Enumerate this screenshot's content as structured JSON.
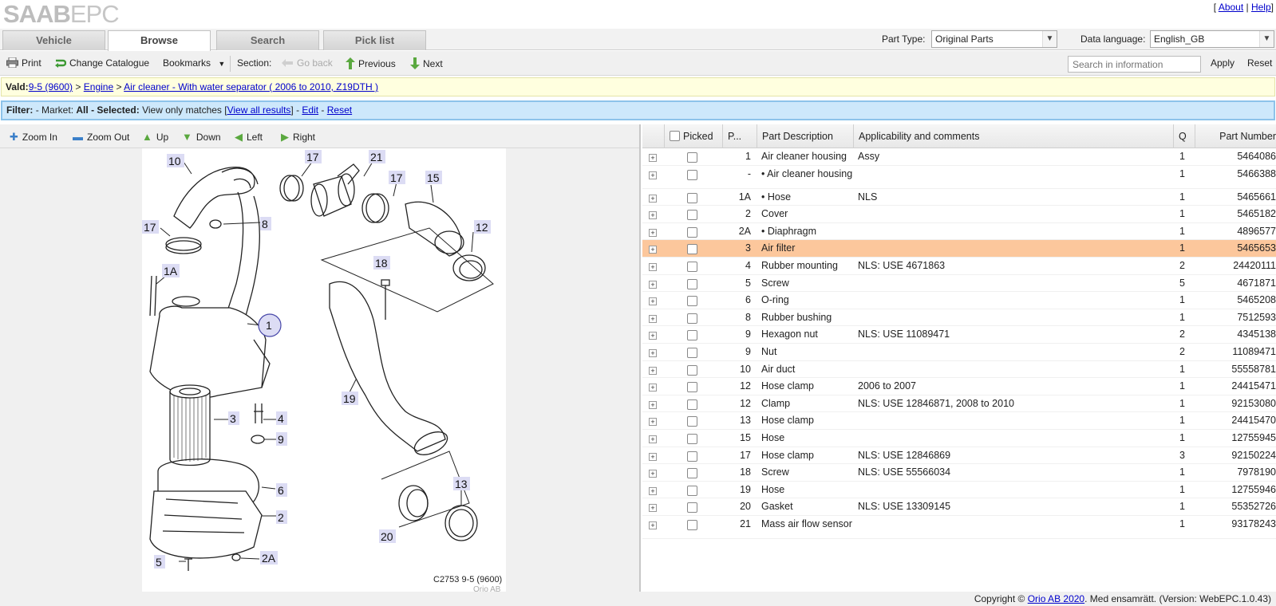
{
  "header": {
    "logo_main": "SAAB",
    "logo_sub": "EPC",
    "links": {
      "about": "About",
      "help": "Help"
    }
  },
  "tabs": [
    "Vehicle",
    "Browse",
    "Search",
    "Pick list"
  ],
  "active_tab": "Browse",
  "part_type": {
    "label": "Part Type:",
    "value": "Original Parts"
  },
  "data_language": {
    "label": "Data language:",
    "value": "English_GB"
  },
  "toolbar": {
    "print": "Print",
    "change_catalogue": "Change Catalogue",
    "bookmarks": "Bookmarks",
    "section": "Section:",
    "go_back": "Go back",
    "previous": "Previous",
    "next": "Next",
    "search_placeholder": "Search in information",
    "apply": "Apply",
    "reset": "Reset"
  },
  "valid_bar": {
    "label": "Vald:",
    "crumb1": "9-5 (9600)",
    "sep": ">",
    "crumb2": "Engine",
    "crumb3": "Air cleaner - With water separator ( 2006 to 2010, Z19DTH )"
  },
  "filter_bar": {
    "filter_label": "Filter:",
    "market_label": "- Market:",
    "market_value": "All",
    "selected_label": "- Selected:",
    "selected_value": "View only matches",
    "view_all": "View all results",
    "edit": "Edit",
    "reset": "Reset"
  },
  "view_tools": {
    "zoom_in": "Zoom In",
    "zoom_out": "Zoom Out",
    "up": "Up",
    "down": "Down",
    "left": "Left",
    "right": "Right"
  },
  "diagram": {
    "caption": "C2753 9-5 (9600)",
    "copyright": "Orio AB",
    "callouts": [
      "10",
      "17",
      "21",
      "17",
      "15",
      "17",
      "8",
      "12",
      "1A",
      "18",
      "1",
      "3",
      "4",
      "9",
      "19",
      "6",
      "2",
      "13",
      "20",
      "5",
      "2A"
    ]
  },
  "table": {
    "headers": {
      "picked": "Picked",
      "pos": "P...",
      "desc": "Part Description",
      "comments": "Applicability and comments",
      "qty": "Q",
      "part_number": "Part Number"
    },
    "rows": [
      {
        "pos": "1",
        "desc": "Air cleaner housing",
        "comments": "Assy",
        "qty": "1",
        "part": "5464086"
      },
      {
        "pos": "-",
        "desc": "• Air cleaner housing",
        "comments": "",
        "qty": "1",
        "part": "5466388"
      },
      {
        "pos": "1A",
        "desc": "• Hose",
        "comments": "NLS",
        "qty": "1",
        "part": "5465661"
      },
      {
        "pos": "2",
        "desc": "Cover",
        "comments": "",
        "qty": "1",
        "part": "5465182"
      },
      {
        "pos": "2A",
        "desc": "• Diaphragm",
        "comments": "",
        "qty": "1",
        "part": "4896577"
      },
      {
        "pos": "3",
        "desc": "Air filter",
        "comments": "",
        "qty": "1",
        "part": "5465653"
      },
      {
        "pos": "4",
        "desc": "Rubber mounting",
        "comments": "NLS: USE 4671863",
        "qty": "2",
        "part": "24420111"
      },
      {
        "pos": "5",
        "desc": "Screw",
        "comments": "",
        "qty": "5",
        "part": "4671871"
      },
      {
        "pos": "6",
        "desc": "O-ring",
        "comments": "",
        "qty": "1",
        "part": "5465208"
      },
      {
        "pos": "8",
        "desc": "Rubber bushing",
        "comments": "",
        "qty": "1",
        "part": "7512593"
      },
      {
        "pos": "9",
        "desc": "Hexagon nut",
        "comments": "NLS: USE 11089471",
        "qty": "2",
        "part": "4345138"
      },
      {
        "pos": "9",
        "desc": "Nut",
        "comments": "",
        "qty": "2",
        "part": "11089471"
      },
      {
        "pos": "10",
        "desc": "Air duct",
        "comments": "",
        "qty": "1",
        "part": "55558781"
      },
      {
        "pos": "12",
        "desc": "Hose clamp",
        "comments": "2006 to 2007",
        "qty": "1",
        "part": "24415471"
      },
      {
        "pos": "12",
        "desc": "Clamp",
        "comments": "NLS: USE 12846871, 2008 to 2010",
        "qty": "1",
        "part": "92153080"
      },
      {
        "pos": "13",
        "desc": "Hose clamp",
        "comments": "",
        "qty": "1",
        "part": "24415470"
      },
      {
        "pos": "15",
        "desc": "Hose",
        "comments": "",
        "qty": "1",
        "part": "12755945"
      },
      {
        "pos": "17",
        "desc": "Hose clamp",
        "comments": "NLS: USE 12846869",
        "qty": "3",
        "part": "92150224"
      },
      {
        "pos": "18",
        "desc": "Screw",
        "comments": "NLS: USE 55566034",
        "qty": "1",
        "part": "7978190"
      },
      {
        "pos": "19",
        "desc": "Hose",
        "comments": "",
        "qty": "1",
        "part": "12755946"
      },
      {
        "pos": "20",
        "desc": "Gasket",
        "comments": "NLS: USE 13309145",
        "qty": "1",
        "part": "55352726"
      },
      {
        "pos": "21",
        "desc": "Mass air flow sensor",
        "comments": "",
        "qty": "1",
        "part": "93178243"
      }
    ],
    "highlighted_row": 5,
    "highlight_color": "#fcc79c"
  },
  "footer": {
    "prefix": "Copyright ©",
    "link": "Orio AB 2020",
    "suffix": ". Med ensamrätt. (Version: WebEPC.1.0.43)"
  }
}
